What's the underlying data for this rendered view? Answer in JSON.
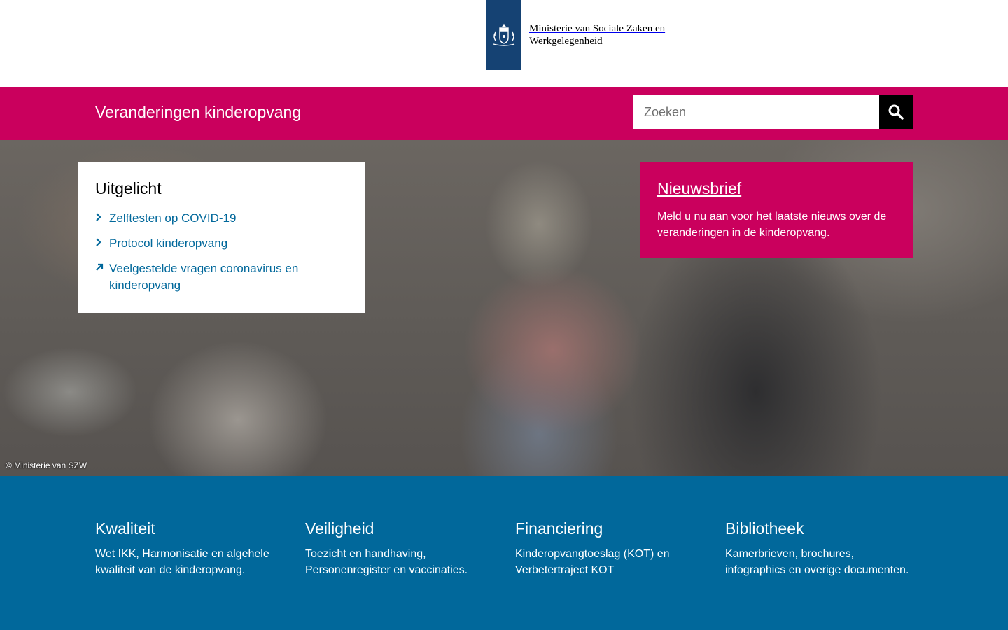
{
  "header": {
    "ministry_line1": "Ministerie van Sociale Zaken en",
    "ministry_line2": "Werkgelegenheid",
    "brand_color": "#154273"
  },
  "title_bar": {
    "site_title": "Veranderingen kinderopvang",
    "accent_color": "#ca005d"
  },
  "search": {
    "placeholder": "Zoeken",
    "value": "",
    "button_icon": "search-icon"
  },
  "featured": {
    "heading": "Uitgelicht",
    "items": [
      {
        "label": "Zelftesten op COVID-19",
        "icon": "chevron-right-icon"
      },
      {
        "label": "Protocol kinderopvang",
        "icon": "chevron-right-icon"
      },
      {
        "label": "Veelgestelde vragen coronavirus en kinderopvang",
        "icon": "external-arrow-icon"
      }
    ]
  },
  "newsletter": {
    "heading": "Nieuwsbrief",
    "text": "Meld u nu aan voor het laatste nieuws over de veranderingen in de kinderopvang."
  },
  "hero": {
    "copyright": "© Ministerie van SZW"
  },
  "topics": [
    {
      "title": "Kwaliteit",
      "description": "Wet IKK, Harmonisatie en algehele kwaliteit van de kinderopvang."
    },
    {
      "title": "Veiligheid",
      "description": "Toezicht en handhaving, Personenregister en vaccinaties."
    },
    {
      "title": "Financiering",
      "description": "Kinderopvangtoeslag (KOT) en Verbetertraject KOT"
    },
    {
      "title": "Bibliotheek",
      "description": "Kamerbrieven, brochures, infographics en overige documenten."
    }
  ],
  "colors": {
    "link": "#01689b",
    "topics_background": "#01689b"
  }
}
